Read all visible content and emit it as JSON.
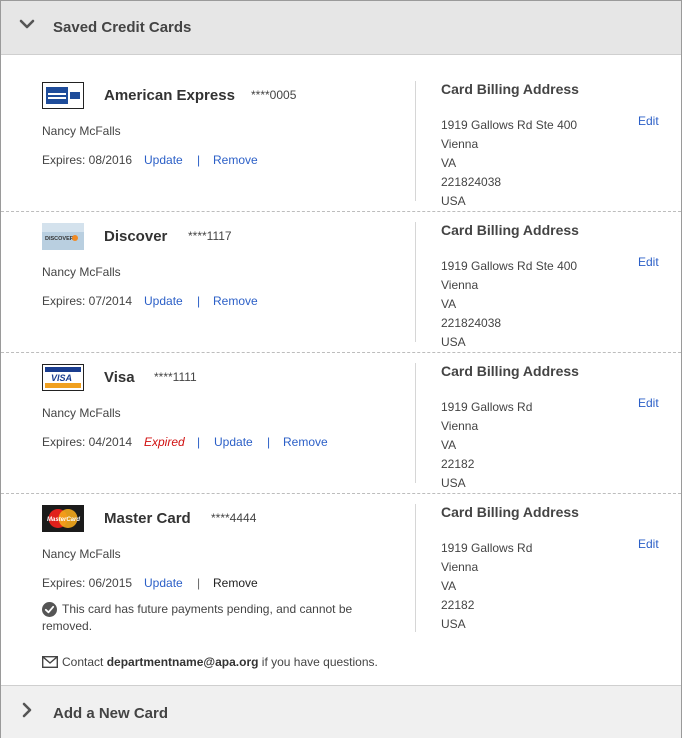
{
  "header": {
    "title": "Saved Credit Cards",
    "icon": "chevron-down-icon"
  },
  "footer": {
    "title": "Add a New Card",
    "icon": "chevron-right-icon"
  },
  "cards": [
    {
      "brand": "American Express",
      "masked": "****0005",
      "logo_icon": "amex-logo-icon",
      "logo_text": "AMERICAN EXPRESS Cards",
      "holder": "Nancy McFalls",
      "expires": "Expires: 08/2016",
      "update": "Update",
      "separator": "|",
      "remove": "Remove",
      "billing_title": "Card Billing Address",
      "edit": "Edit",
      "address": [
        "1919 Gallows Rd Ste 400",
        "Vienna",
        "VA",
        "221824038",
        "USA"
      ]
    },
    {
      "brand": "Discover",
      "masked": "****1117",
      "logo_icon": "discover-logo-icon",
      "logo_text": "DISCOVER",
      "holder": "Nancy McFalls",
      "expires": "Expires: 07/2014",
      "update": "Update",
      "separator": "|",
      "remove": "Remove",
      "billing_title": "Card Billing Address",
      "edit": "Edit",
      "address": [
        "1919 Gallows Rd Ste 400",
        "Vienna",
        "VA",
        "221824038",
        "USA"
      ]
    },
    {
      "brand": "Visa",
      "masked": "****1111",
      "logo_icon": "visa-logo-icon",
      "logo_text": "VISA",
      "holder": "Nancy McFalls",
      "expires": "Expires: 04/2014",
      "expired_label": "Expired",
      "update": "Update",
      "separator": "|",
      "remove": "Remove",
      "billing_title": "Card Billing Address",
      "edit": "Edit",
      "address": [
        "1919 Gallows Rd",
        "Vienna",
        "VA",
        "22182",
        "USA"
      ]
    },
    {
      "brand": "Master Card",
      "masked": "****4444",
      "logo_icon": "mastercard-logo-icon",
      "logo_text": "MasterCard",
      "holder": "Nancy McFalls",
      "expires": "Expires: 06/2015",
      "update": "Update",
      "separator": "|",
      "remove": "Remove",
      "billing_title": "Card Billing Address",
      "edit": "Edit",
      "address": [
        "1919 Gallows Rd",
        "Vienna",
        "VA",
        "22182",
        "USA"
      ]
    }
  ],
  "pending_note": "This card has future payments pending, and cannot be removed.",
  "contact": {
    "prefix": "Contact",
    "email": "departmentname@apa.org",
    "suffix": "if you have questions."
  },
  "colors": {
    "link": "#2b5fc7",
    "expired": "#d01010",
    "header_bg": "#e6e6e6"
  }
}
